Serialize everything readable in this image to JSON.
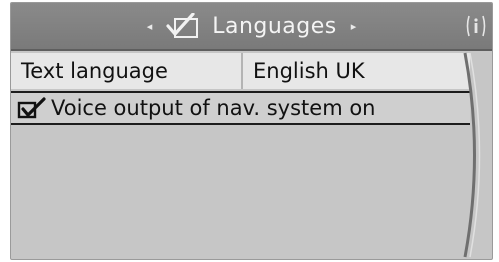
{
  "header": {
    "title": "Languages",
    "left_arrow": "◂",
    "right_arrow": "▸",
    "menu_icon": "checkbox-icon",
    "info_icon": "info-icon"
  },
  "settings": {
    "text_language": {
      "label": "Text language",
      "value": "English UK"
    },
    "voice_output": {
      "label": "Voice output of nav. system on",
      "checked": true
    }
  },
  "colors": {
    "header_bg": "#7f7f7f",
    "screen_bg": "#c6c6c6",
    "row_bg": "#e7e7e7"
  }
}
